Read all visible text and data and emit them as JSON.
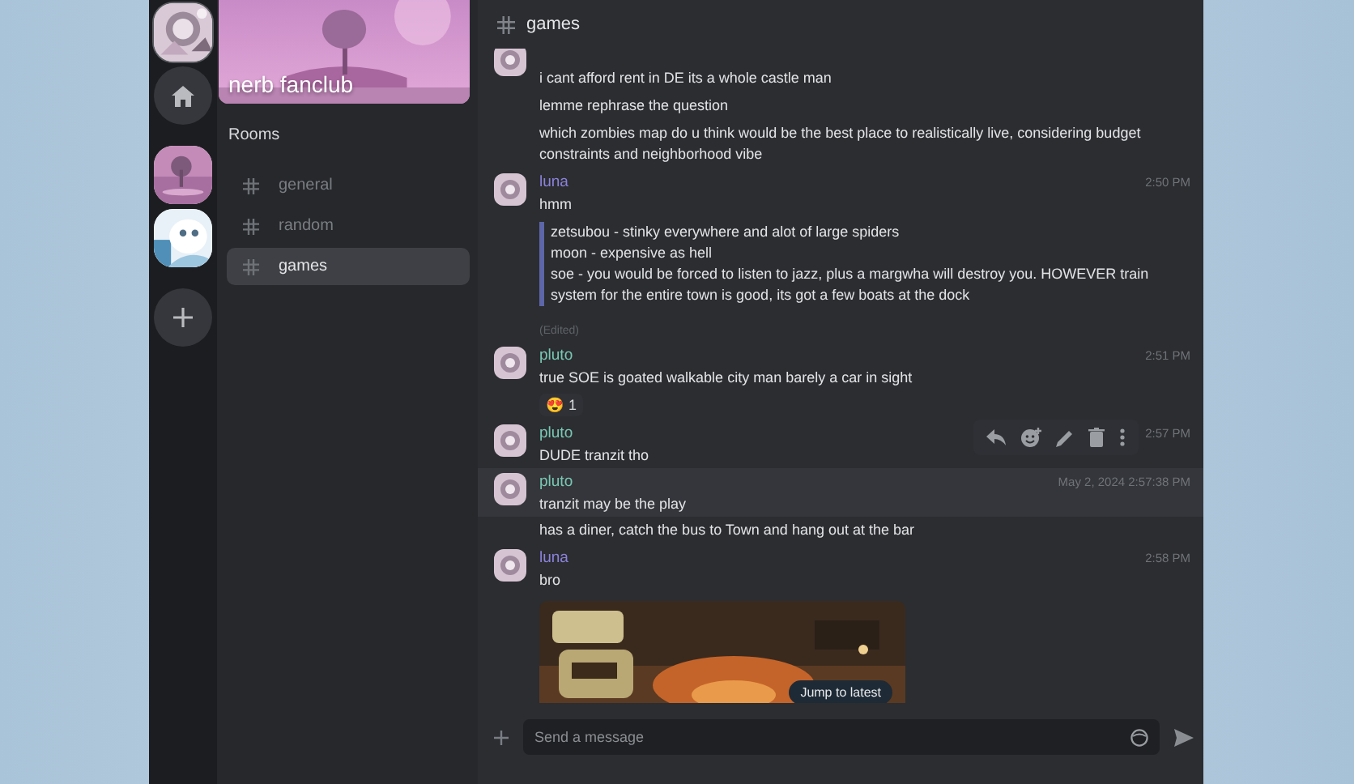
{
  "servers": [
    {
      "kind": "avatar",
      "selected": true
    },
    {
      "kind": "home",
      "selected": false
    },
    {
      "kind": "picture",
      "selected": false
    },
    {
      "kind": "picture",
      "selected": false
    },
    {
      "kind": "add",
      "selected": false
    }
  ],
  "space": {
    "name": "nerb fanclub"
  },
  "rooms_heading": "Rooms",
  "rooms": [
    {
      "name": "general",
      "selected": false
    },
    {
      "name": "random",
      "selected": false
    },
    {
      "name": "games",
      "selected": true
    }
  ],
  "header": {
    "channel": "games"
  },
  "messages": [
    {
      "avatar": true,
      "lines": [
        "i cant afford rent in DE its a whole castle man"
      ]
    },
    {
      "lines": [
        "lemme rephrase the question"
      ]
    },
    {
      "lines": [
        "which zombies map do u think would be the best place to realistically live, considering budget constraints and neighborhood vibe"
      ]
    },
    {
      "avatar": true,
      "author": "luna",
      "color": "#8c82db",
      "time": "2:50 PM",
      "lines": [
        "hmm"
      ],
      "quote": [
        "zetsubou - stinky everywhere and alot of large spiders",
        "moon - expensive as hell",
        "soe - you would be forced to listen to jazz, plus a margwha will destroy you. HOWEVER train system for the entire town is good, its got a few boats at the dock"
      ],
      "edited": "(Edited)"
    },
    {
      "avatar": true,
      "author": "pluto",
      "color": "#79c7b4",
      "time": "2:51 PM",
      "lines": [
        "true SOE is goated walkable city man barely a car in sight"
      ],
      "reaction": {
        "emoji": "😍",
        "count": "1"
      }
    },
    {
      "avatar": true,
      "author": "pluto",
      "color": "#79c7b4",
      "time": "2:57 PM",
      "lines": [
        "DUDE tranzit tho"
      ],
      "toolbar": true
    },
    {
      "avatar": true,
      "author": "pluto",
      "color": "#79c7b4",
      "time": "May 2, 2024 2:57:38 PM",
      "lines": [
        "tranzit may be the play"
      ],
      "highlighted": true
    },
    {
      "lines": [
        "has a diner, catch the bus to Town and hang out at the bar"
      ]
    },
    {
      "avatar": true,
      "author": "luna",
      "color": "#8c82db",
      "time": "2:58 PM",
      "lines": [
        "bro"
      ],
      "image": {
        "kind": "picture"
      },
      "jump": "Jump to latest"
    }
  ],
  "composer": {
    "placeholder": "Send a message"
  }
}
